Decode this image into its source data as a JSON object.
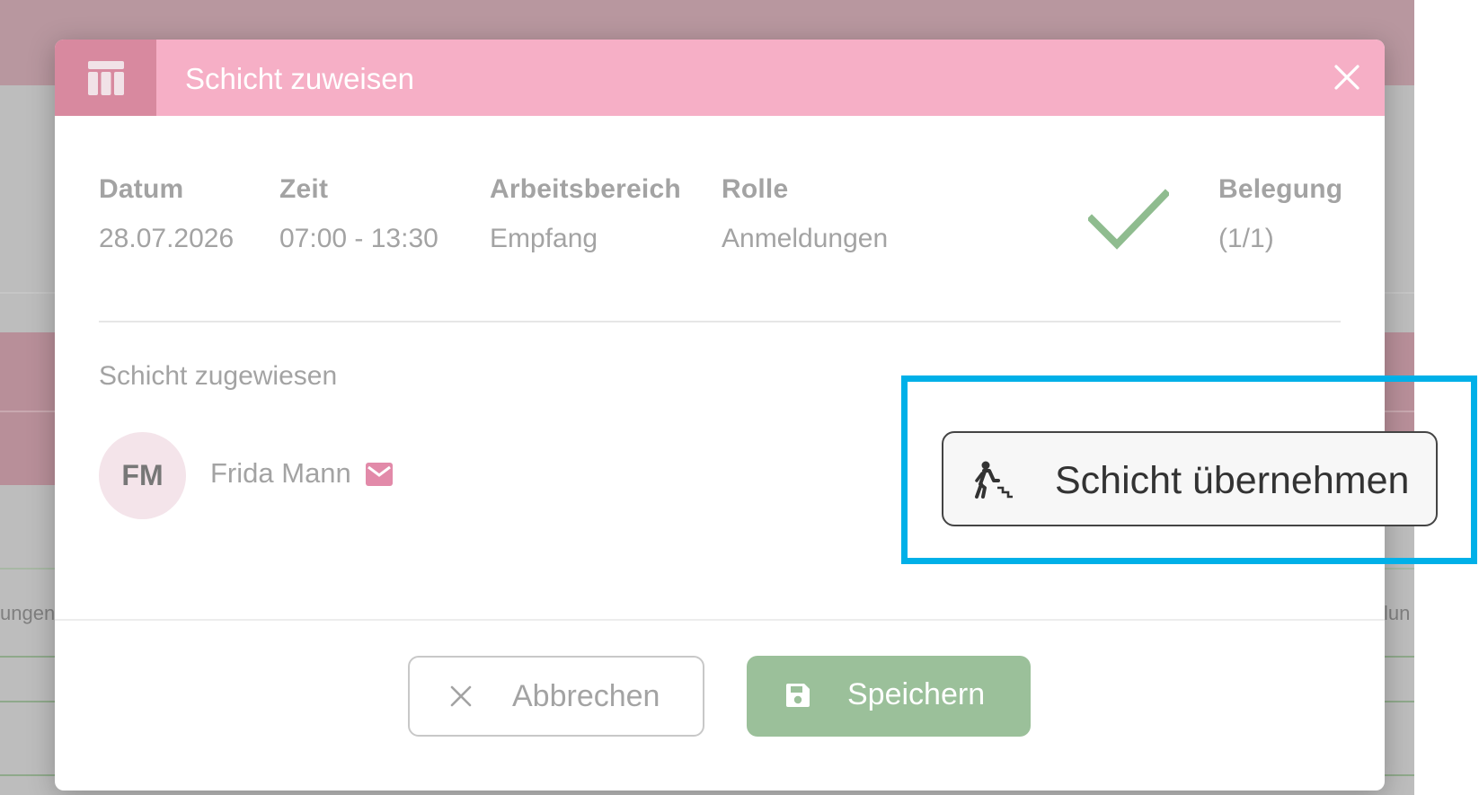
{
  "modal": {
    "title": "Schicht zuweisen",
    "header_icon": "calendar-table-icon",
    "close_icon": "close-icon"
  },
  "shift_info": {
    "date_label": "Datum",
    "date_value": "28.07.2026",
    "time_label": "Zeit",
    "time_value": "07:00 - 13:30",
    "area_label": "Arbeitsbereich",
    "area_value": "Empfang",
    "role_label": "Rolle",
    "role_value": "Anmeldungen",
    "status_icon": "checkmark-icon",
    "occupancy_label": "Belegung",
    "occupancy_value": "(1/1)"
  },
  "assigned": {
    "section_label": "Schicht zugewiesen",
    "avatar_initials": "FM",
    "name": "Frida Mann",
    "mail_icon": "mail-icon"
  },
  "actions": {
    "takeover_label": "Schicht übernehmen",
    "takeover_icon": "person-walking-stairs-icon",
    "cancel_label": "Abbrechen",
    "cancel_icon": "close-icon",
    "save_label": "Speichern",
    "save_icon": "floppy-disk-icon"
  },
  "background": {
    "left_fragment": "ungen",
    "right_fragment": "lun"
  },
  "colors": {
    "header": "#f6afc6",
    "header_icon_box": "#d8899f",
    "check": "#8fbc8f",
    "save_button": "#9bc09a",
    "highlight": "#00b0e8"
  }
}
